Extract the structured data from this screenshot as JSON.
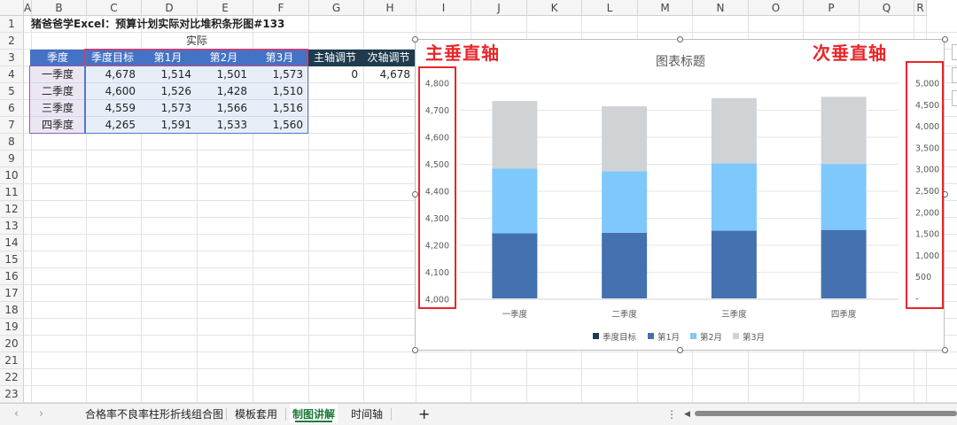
{
  "sheet": {
    "columns": [
      "A",
      "B",
      "C",
      "D",
      "E",
      "F",
      "G",
      "H",
      "I",
      "J",
      "K",
      "L",
      "M",
      "N",
      "O",
      "P",
      "Q",
      "R"
    ],
    "rows": [
      "1",
      "2",
      "3",
      "4",
      "5",
      "6",
      "7",
      "8",
      "9",
      "10",
      "11",
      "12",
      "13",
      "14",
      "15",
      "16",
      "17",
      "18",
      "19",
      "20",
      "21",
      "22",
      "23"
    ],
    "title": "猪爸爸学Excel：预算计划实际对比堆积条形图#133",
    "actual_label": "实际",
    "headers": [
      "季度",
      "季度目标",
      "第1月",
      "第2月",
      "第3月"
    ],
    "extra_headers": [
      "主轴调节",
      "次轴调节"
    ],
    "extra_values": [
      "0",
      "4,678"
    ],
    "table": [
      [
        "一季度",
        "4,678",
        "1,514",
        "1,501",
        "1,573"
      ],
      [
        "二季度",
        "4,600",
        "1,526",
        "1,428",
        "1,510"
      ],
      [
        "三季度",
        "4,559",
        "1,573",
        "1,566",
        "1,516"
      ],
      [
        "四季度",
        "4,265",
        "1,591",
        "1,533",
        "1,560"
      ]
    ]
  },
  "chart": {
    "title": "图表标题",
    "primary_axis_note": "主垂直轴",
    "secondary_axis_note": "次垂直轴",
    "left_ticks": [
      "4,800",
      "4,700",
      "4,600",
      "4,500",
      "4,400",
      "4,300",
      "4,200",
      "4,100",
      "4,000"
    ],
    "right_ticks": [
      "5,000",
      "4,500",
      "4,000",
      "3,500",
      "3,000",
      "2,500",
      "2,000",
      "1,500",
      "1,000",
      "500",
      "-"
    ],
    "legend": [
      "季度目标",
      "第1月",
      "第2月",
      "第3月"
    ],
    "colors": {
      "target": "#1f3b4d",
      "m1": "#4472b0",
      "m2": "#7fc8fb",
      "m3": "#d0d3d6"
    }
  },
  "chart_data": {
    "type": "bar",
    "stacked": true,
    "title": "图表标题",
    "categories": [
      "一季度",
      "二季度",
      "三季度",
      "四季度"
    ],
    "primary_ylim": [
      4000,
      4800
    ],
    "secondary_ylim": [
      0,
      5000
    ],
    "series": [
      {
        "name": "季度目标",
        "axis": "primary",
        "values": [
          4678,
          4600,
          4559,
          4265
        ]
      },
      {
        "name": "第1月",
        "axis": "secondary",
        "values": [
          1514,
          1526,
          1573,
          1591
        ]
      },
      {
        "name": "第2月",
        "axis": "secondary",
        "values": [
          1501,
          1428,
          1566,
          1533
        ]
      },
      {
        "name": "第3月",
        "axis": "secondary",
        "values": [
          1573,
          1510,
          1516,
          1560
        ]
      }
    ],
    "legend_position": "bottom",
    "grid": true
  },
  "tabs": {
    "items": [
      "合格率不良率柱形折线组合图",
      "模板套用",
      "制图讲解",
      "时间轴"
    ],
    "active": "制图讲解",
    "add": "+"
  }
}
